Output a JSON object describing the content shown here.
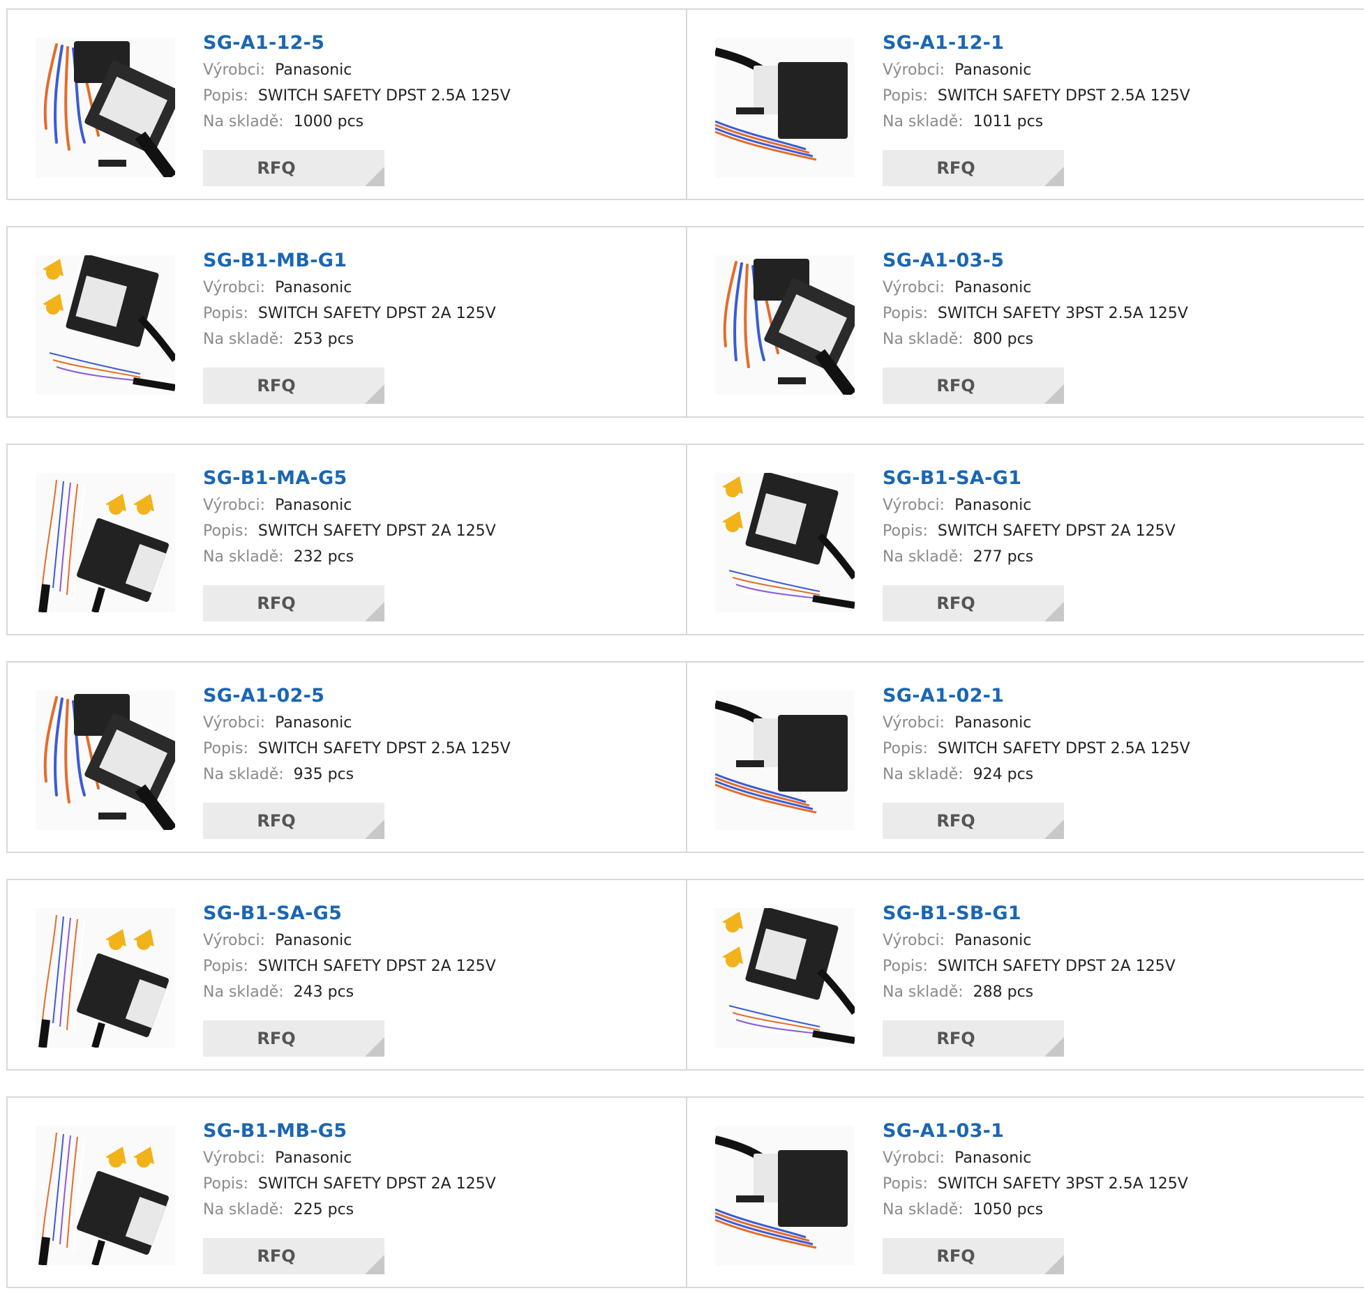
{
  "labels": {
    "manufacturer": "Výrobci:",
    "description": "Popis:",
    "stock": "Na skladě:",
    "rfq": "RFQ"
  },
  "colors": {
    "link": "#1a66b3",
    "border": "#d8d8d8",
    "button_bg": "#ebebeb"
  },
  "products": [
    {
      "part": "SG-A1-12-5",
      "manufacturer": "Panasonic",
      "description": "SWITCH SAFETY DPST 2.5A 125V",
      "stock": "1000 pcs",
      "image": "a1-vertical"
    },
    {
      "part": "SG-A1-12-1",
      "manufacturer": "Panasonic",
      "description": "SWITCH SAFETY DPST 2.5A 125V",
      "stock": "1011 pcs",
      "image": "a1-horizontal"
    },
    {
      "part": "SG-B1-MB-G1",
      "manufacturer": "Panasonic",
      "description": "SWITCH SAFETY DPST 2A 125V",
      "stock": "253 pcs",
      "image": "b1-keys-left"
    },
    {
      "part": "SG-A1-03-5",
      "manufacturer": "Panasonic",
      "description": "SWITCH SAFETY 3PST 2.5A 125V",
      "stock": "800 pcs",
      "image": "a1-vertical"
    },
    {
      "part": "SG-B1-MA-G5",
      "manufacturer": "Panasonic",
      "description": "SWITCH SAFETY DPST 2A 125V",
      "stock": "232 pcs",
      "image": "b1-keys-top"
    },
    {
      "part": "SG-B1-SA-G1",
      "manufacturer": "Panasonic",
      "description": "SWITCH SAFETY DPST 2A 125V",
      "stock": "277 pcs",
      "image": "b1-keys-left"
    },
    {
      "part": "SG-A1-02-5",
      "manufacturer": "Panasonic",
      "description": "SWITCH SAFETY DPST 2.5A 125V",
      "stock": "935 pcs",
      "image": "a1-vertical"
    },
    {
      "part": "SG-A1-02-1",
      "manufacturer": "Panasonic",
      "description": "SWITCH SAFETY DPST 2.5A 125V",
      "stock": "924 pcs",
      "image": "a1-horizontal"
    },
    {
      "part": "SG-B1-SA-G5",
      "manufacturer": "Panasonic",
      "description": "SWITCH SAFETY DPST 2A 125V",
      "stock": "243 pcs",
      "image": "b1-keys-top"
    },
    {
      "part": "SG-B1-SB-G1",
      "manufacturer": "Panasonic",
      "description": "SWITCH SAFETY DPST 2A 125V",
      "stock": "288 pcs",
      "image": "b1-keys-left"
    },
    {
      "part": "SG-B1-MB-G5",
      "manufacturer": "Panasonic",
      "description": "SWITCH SAFETY DPST 2A 125V",
      "stock": "225 pcs",
      "image": "b1-keys-top"
    },
    {
      "part": "SG-A1-03-1",
      "manufacturer": "Panasonic",
      "description": "SWITCH SAFETY 3PST 2.5A 125V",
      "stock": "1050 pcs",
      "image": "a1-horizontal"
    }
  ]
}
